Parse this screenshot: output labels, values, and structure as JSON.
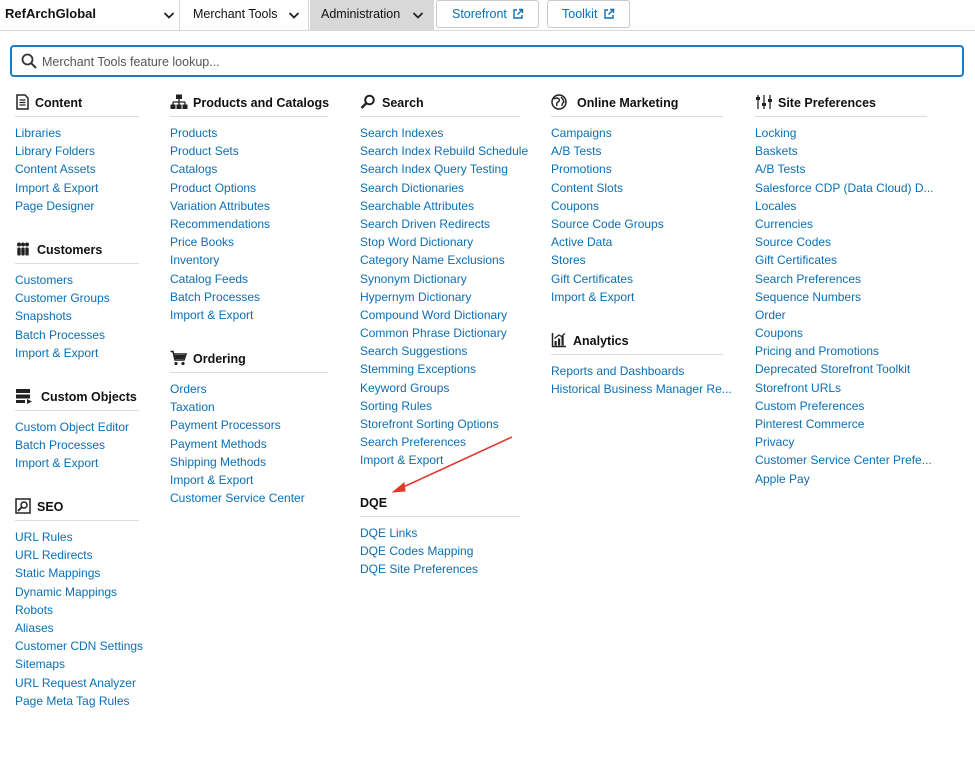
{
  "topbar": {
    "site_label": "RefArchGlobal",
    "merchant_tools_label": "Merchant Tools",
    "administration_label": "Administration",
    "storefront_label": "Storefront",
    "toolkit_label": "Toolkit"
  },
  "search": {
    "placeholder": "Merchant Tools feature lookup..."
  },
  "groups": {
    "content": {
      "title": "Content",
      "links": [
        "Libraries",
        "Library Folders",
        "Content Assets",
        "Import & Export",
        "Page Designer"
      ]
    },
    "customers": {
      "title": "Customers",
      "links": [
        "Customers",
        "Customer Groups",
        "Snapshots",
        "Batch Processes",
        "Import & Export"
      ]
    },
    "custom_objects": {
      "title": "Custom Objects",
      "links": [
        "Custom Object Editor",
        "Batch Processes",
        "Import & Export"
      ]
    },
    "seo": {
      "title": "SEO",
      "links": [
        "URL Rules",
        "URL Redirects",
        "Static Mappings",
        "Dynamic Mappings",
        "Robots",
        "Aliases",
        "Customer CDN Settings",
        "Sitemaps",
        "URL Request Analyzer",
        "Page Meta Tag Rules"
      ]
    },
    "products": {
      "title": "Products and Catalogs",
      "links": [
        "Products",
        "Product Sets",
        "Catalogs",
        "Product Options",
        "Variation Attributes",
        "Recommendations",
        "Price Books",
        "Inventory",
        "Catalog Feeds",
        "Batch Processes",
        "Import & Export"
      ]
    },
    "ordering": {
      "title": "Ordering",
      "links": [
        "Orders",
        "Taxation",
        "Payment Processors",
        "Payment Methods",
        "Shipping Methods",
        "Import & Export",
        "Customer Service Center"
      ]
    },
    "search": {
      "title": "Search",
      "links": [
        "Search Indexes",
        "Search Index Rebuild Schedule",
        "Search Index Query Testing",
        "Search Dictionaries",
        "Searchable Attributes",
        "Search Driven Redirects",
        "Stop Word Dictionary",
        "Category Name Exclusions",
        "Synonym Dictionary",
        "Hypernym Dictionary",
        "Compound Word Dictionary",
        "Common Phrase Dictionary",
        "Search Suggestions",
        "Stemming Exceptions",
        "Keyword Groups",
        "Sorting Rules",
        "Storefront Sorting Options",
        "Search Preferences",
        "Import & Export"
      ]
    },
    "dqe": {
      "title": "DQE",
      "links": [
        "DQE Links",
        "DQE Codes Mapping",
        "DQE Site Preferences"
      ]
    },
    "online_marketing": {
      "title": "Online Marketing",
      "links": [
        "Campaigns",
        "A/B Tests",
        "Promotions",
        "Content Slots",
        "Coupons",
        "Source Code Groups",
        "Active Data",
        "Stores",
        "Gift Certificates",
        "Import & Export"
      ]
    },
    "analytics": {
      "title": "Analytics",
      "links": [
        "Reports and Dashboards",
        "Historical Business Manager Re..."
      ]
    },
    "site_preferences": {
      "title": "Site Preferences",
      "links": [
        "Locking",
        "Baskets",
        "A/B Tests",
        "Salesforce CDP (Data Cloud) D...",
        "Locales",
        "Currencies",
        "Source Codes",
        "Gift Certificates",
        "Search Preferences",
        "Sequence Numbers",
        "Order",
        "Coupons",
        "Pricing and Promotions",
        "Deprecated Storefront Toolkit",
        "Storefront URLs",
        "Custom Preferences",
        "Pinterest Commerce",
        "Privacy",
        "Customer Service Center Prefe...",
        "Apple Pay"
      ]
    }
  },
  "colors": {
    "link": "#0b6fb5",
    "search_border": "#1b7bc4",
    "active_tab": "#d8d8d8",
    "annotation_arrow": "#e03b2f"
  },
  "icons": {
    "content": "document-icon",
    "customers": "people-icon",
    "custom_objects": "server-icon",
    "seo": "seo-icon",
    "products": "hierarchy-icon",
    "ordering": "cart-icon",
    "search": "magnifier-icon",
    "online_marketing": "globe-icon",
    "analytics": "chart-icon",
    "site_preferences": "sliders-icon"
  }
}
